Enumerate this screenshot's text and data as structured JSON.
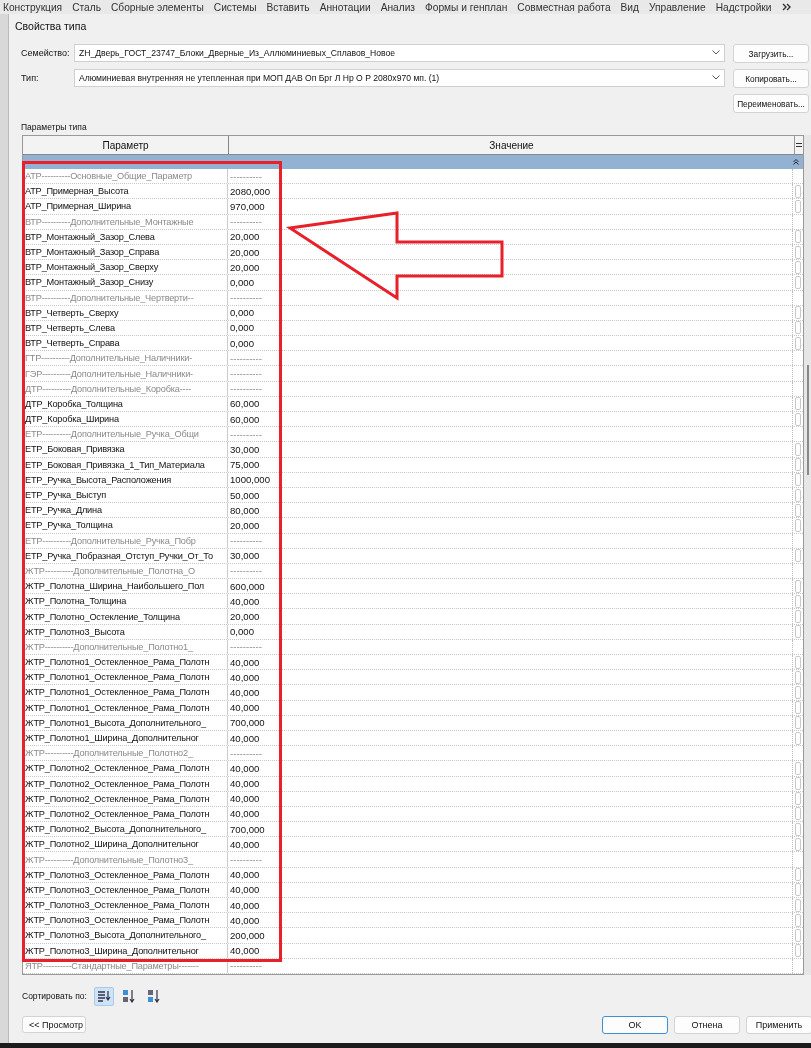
{
  "menu_bar": {
    "items": [
      "Конструкция",
      "Сталь",
      "Сборные элементы",
      "Системы",
      "Вставить",
      "Аннотации",
      "Анализ",
      "Формы и генплан",
      "Совместная работа",
      "Вид",
      "Управление",
      "Надстройки"
    ]
  },
  "dialog": {
    "title": "Свойства типа",
    "fields": [
      {
        "label": "Семейство:",
        "value": "ZH_Дверь_ГОСТ_23747_Блоки_Дверные_Из_Аллюминиевых_Сплавов_Новое"
      },
      {
        "label": "Тип:",
        "value": "Алюминиевая внутренняя не утепленная при МОП ДАВ Оп Брг Л Нр О Р 2080х970 мп. (1)"
      }
    ],
    "side_buttons": [
      "Загрузить...",
      "Копировать...",
      "Переименовать..."
    ],
    "section_label": "Параметры типа",
    "table": {
      "columns": [
        "Параметр",
        "Значение"
      ],
      "rows": [
        {
          "kind": "group",
          "name": "АТР----------Основные_Общие_Параметр",
          "value": "----------"
        },
        {
          "kind": "param",
          "name": "АТР_Примерная_Высота",
          "value": "2080,000"
        },
        {
          "kind": "param",
          "name": "АТР_Примерная_Ширина",
          "value": "970,000"
        },
        {
          "kind": "group",
          "name": "ВТР----------Дополнительные_Монтажные",
          "value": "----------"
        },
        {
          "kind": "param",
          "name": "ВТР_Монтажный_Зазор_Слева",
          "value": "20,000"
        },
        {
          "kind": "param",
          "name": "ВТР_Монтажный_Зазор_Справа",
          "value": "20,000"
        },
        {
          "kind": "param",
          "name": "ВТР_Монтажный_Зазор_Сверху",
          "value": "20,000"
        },
        {
          "kind": "param",
          "name": "ВТР_Монтажный_Зазор_Снизу",
          "value": "0,000"
        },
        {
          "kind": "group",
          "name": "ВТР----------Дополнительные_Чертверти--",
          "value": "----------"
        },
        {
          "kind": "param",
          "name": "ВТР_Четверть_Сверху",
          "value": "0,000"
        },
        {
          "kind": "param",
          "name": "ВТР_Четверть_Слева",
          "value": "0,000"
        },
        {
          "kind": "param",
          "name": "ВТР_Четверть_Справа",
          "value": "0,000"
        },
        {
          "kind": "group",
          "name": "ГТР----------Дополнительные_Наличники-",
          "value": "----------"
        },
        {
          "kind": "group",
          "name": "ГЭР----------Дополнительные_Наличники-",
          "value": "----------"
        },
        {
          "kind": "group",
          "name": "ДТР----------Дополнительные_Коробка----",
          "value": "----------"
        },
        {
          "kind": "param",
          "name": "ДТР_Коробка_Толщина",
          "value": "60,000"
        },
        {
          "kind": "param",
          "name": "ДТР_Коробка_Ширина",
          "value": "60,000"
        },
        {
          "kind": "group",
          "name": "ЕТР----------Дополнительные_Ручка_Общи",
          "value": "----------"
        },
        {
          "kind": "param",
          "name": "ЕТР_Боковая_Привязка",
          "value": "30,000"
        },
        {
          "kind": "param",
          "name": "ЕТР_Боковая_Привязка_1_Тип_Материала",
          "value": "75,000"
        },
        {
          "kind": "param",
          "name": "ЕТР_Ручка_Высота_Расположения",
          "value": "1000,000"
        },
        {
          "kind": "param",
          "name": "ЕТР_Ручка_Выступ",
          "value": "50,000"
        },
        {
          "kind": "param",
          "name": "ЕТР_Ручка_Длина",
          "value": "80,000"
        },
        {
          "kind": "param",
          "name": "ЕТР_Ручка_Толщина",
          "value": "20,000"
        },
        {
          "kind": "group",
          "name": "ЕТР----------Дополнительные_Ручка_Побр",
          "value": "----------"
        },
        {
          "kind": "param",
          "name": "ЕТР_Ручка_Побразная_Отступ_Ручки_От_То",
          "value": "30,000"
        },
        {
          "kind": "group",
          "name": "ЖТР----------Дополнительные_Полотна_О",
          "value": "----------"
        },
        {
          "kind": "param",
          "name": "ЖТР_Полотна_Ширина_Наибольшего_Пол",
          "value": "600,000"
        },
        {
          "kind": "param",
          "name": "ЖТР_Полотна_Толщина",
          "value": "40,000"
        },
        {
          "kind": "param",
          "name": "ЖТР_Полотно_Остекление_Толщина",
          "value": "20,000"
        },
        {
          "kind": "param",
          "name": "ЖТР_Полотно3_Высота",
          "value": "0,000"
        },
        {
          "kind": "group",
          "name": "ЖТР----------Дополнительные_Полотно1_",
          "value": "----------"
        },
        {
          "kind": "param",
          "name": "ЖТР_Полотно1_Остекленное_Рама_Полотн",
          "value": "40,000"
        },
        {
          "kind": "param",
          "name": "ЖТР_Полотно1_Остекленное_Рама_Полотн",
          "value": "40,000"
        },
        {
          "kind": "param",
          "name": "ЖТР_Полотно1_Остекленное_Рама_Полотн",
          "value": "40,000"
        },
        {
          "kind": "param",
          "name": "ЖТР_Полотно1_Остекленное_Рама_Полотн",
          "value": "40,000"
        },
        {
          "kind": "param",
          "name": "ЖТР_Полотно1_Высота_Дополнительного_",
          "value": "700,000"
        },
        {
          "kind": "param",
          "name": "ЖТР_Полотно1_Ширина_Дополнительног",
          "value": "40,000"
        },
        {
          "kind": "group",
          "name": "ЖТР----------Дополнительные_Полотно2_",
          "value": "----------"
        },
        {
          "kind": "param",
          "name": "ЖТР_Полотно2_Остекленное_Рама_Полотн",
          "value": "40,000"
        },
        {
          "kind": "param",
          "name": "ЖТР_Полотно2_Остекленное_Рама_Полотн",
          "value": "40,000"
        },
        {
          "kind": "param",
          "name": "ЖТР_Полотно2_Остекленное_Рама_Полотн",
          "value": "40,000"
        },
        {
          "kind": "param",
          "name": "ЖТР_Полотно2_Остекленное_Рама_Полотн",
          "value": "40,000"
        },
        {
          "kind": "param",
          "name": "ЖТР_Полотно2_Высота_Дополнительного_",
          "value": "700,000"
        },
        {
          "kind": "param",
          "name": "ЖТР_Полотно2_Ширина_Дополнительног",
          "value": "40,000"
        },
        {
          "kind": "group",
          "name": "ЖТР----------Дополнительные_Полотно3_",
          "value": "----------"
        },
        {
          "kind": "param",
          "name": "ЖТР_Полотно3_Остекленное_Рама_Полотн",
          "value": "40,000"
        },
        {
          "kind": "param",
          "name": "ЖТР_Полотно3_Остекленное_Рама_Полотн",
          "value": "40,000"
        },
        {
          "kind": "param",
          "name": "ЖТР_Полотно3_Остекленное_Рама_Полотн",
          "value": "40,000"
        },
        {
          "kind": "param",
          "name": "ЖТР_Полотно3_Остекленное_Рама_Полотн",
          "value": "40,000"
        },
        {
          "kind": "param",
          "name": "ЖТР_Полотно3_Высота_Дополнительного_",
          "value": "200,000"
        },
        {
          "kind": "param",
          "name": "ЖТР_Полотно3_Ширина_Дополнительног",
          "value": "40,000"
        },
        {
          "kind": "group",
          "name": "ЯТР----------Стандартные_Параметры-------",
          "value": "----------"
        }
      ]
    },
    "sort": {
      "label": "Сортировать по:",
      "options": [
        {
          "kind": "order",
          "selected": true
        },
        {
          "kind": "ascending",
          "selected": false
        },
        {
          "kind": "descending",
          "selected": false
        }
      ]
    },
    "preview_button": "<< Просмотр",
    "footer_buttons": [
      "OK",
      "Отнена",
      "Применить"
    ]
  }
}
